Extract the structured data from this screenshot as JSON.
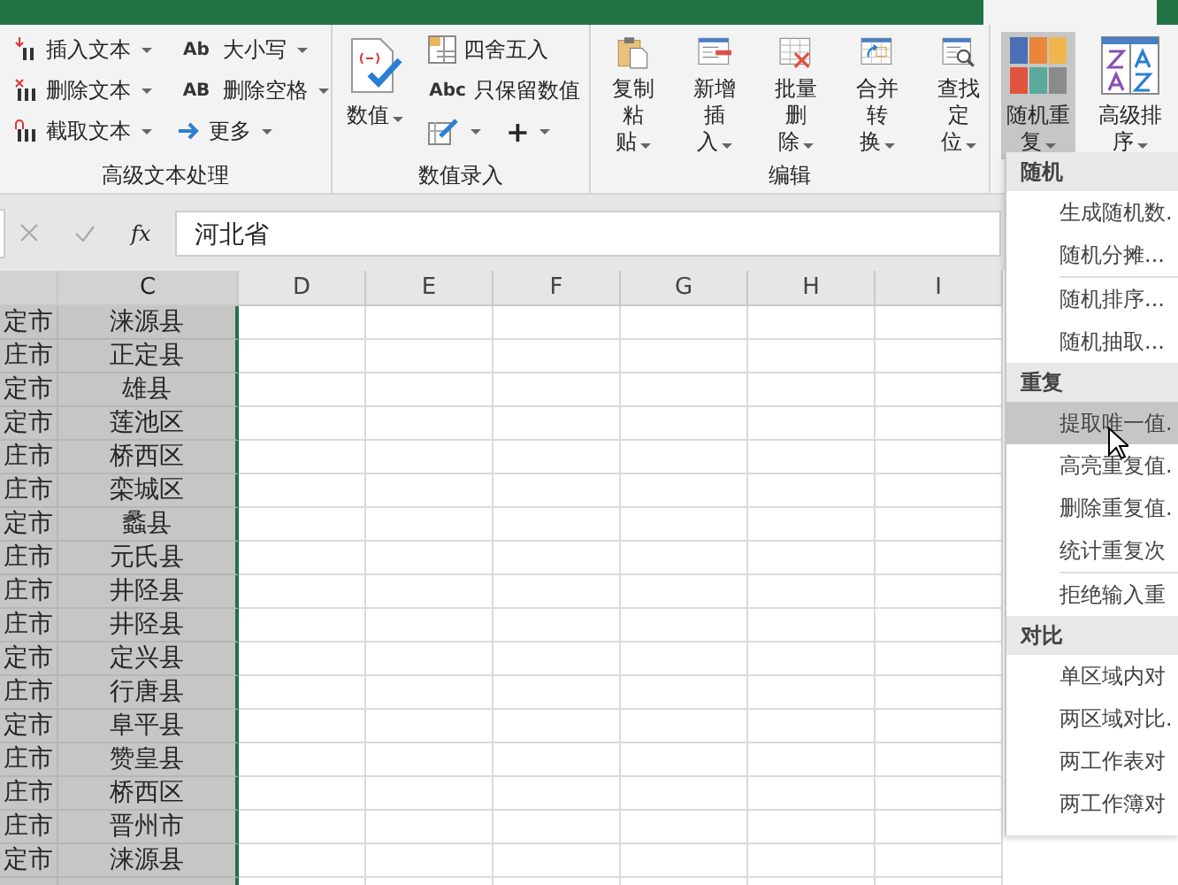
{
  "ribbon": {
    "groups": [
      {
        "label": "高级文本处理",
        "columns": [
          [
            {
              "label": "插入文本",
              "dropdown": true
            },
            {
              "label": "删除文本",
              "dropdown": true
            },
            {
              "label": "截取文本",
              "dropdown": true
            }
          ],
          [
            {
              "label": "大小写",
              "glyph": "Ab",
              "dropdown": true
            },
            {
              "label": "删除空格",
              "glyph": "AB",
              "dropdown": true
            },
            {
              "label": "更多",
              "dropdown": true
            }
          ]
        ]
      },
      {
        "label": "数值录入",
        "big": [
          {
            "label": [
              "数值"
            ],
            "dropdown": true,
            "pressed": false
          }
        ],
        "columns": [
          [
            {
              "label": "四舍五入",
              "dropdown": false
            },
            {
              "label": "只保留数值",
              "glyph": "Abc",
              "dropdown": false
            }
          ]
        ],
        "icon_row": [
          {
            "dropdown": true
          },
          {
            "glyph": "+",
            "dropdown": true
          }
        ]
      },
      {
        "label": "编辑",
        "big": [
          {
            "label": [
              "复制粘",
              "贴"
            ],
            "dropdown": true,
            "pressed": false
          },
          {
            "label": [
              "新增插",
              "入"
            ],
            "dropdown": true,
            "pressed": false
          },
          {
            "label": [
              "批量删",
              "除"
            ],
            "dropdown": true,
            "pressed": false
          },
          {
            "label": [
              "合并转",
              "换"
            ],
            "dropdown": true,
            "pressed": false
          },
          {
            "label": [
              "查找定",
              "位"
            ],
            "dropdown": true,
            "pressed": false
          }
        ]
      },
      {
        "big": [
          {
            "label": [
              "随机重",
              "复"
            ],
            "dropdown": true,
            "pressed": true
          },
          {
            "label": [
              "高级排",
              "序"
            ],
            "dropdown": true,
            "pressed": false
          }
        ]
      }
    ]
  },
  "formula_bar": {
    "fx": "fx",
    "value": "河北省"
  },
  "sheet": {
    "columns": [
      {
        "selected": true
      },
      {
        "header": "C",
        "selected": true
      },
      {
        "header": "D",
        "selected": false
      },
      {
        "header": "E",
        "selected": false
      },
      {
        "header": "F",
        "selected": false
      },
      {
        "header": "G",
        "selected": false
      },
      {
        "header": "H",
        "selected": false
      },
      {
        "header": "I",
        "selected": false
      }
    ],
    "rows": [
      [
        "定市",
        "涞源县"
      ],
      [
        "庄市",
        "正定县"
      ],
      [
        "定市",
        "雄县"
      ],
      [
        "定市",
        "莲池区"
      ],
      [
        "庄市",
        "桥西区"
      ],
      [
        "庄市",
        "栾城区"
      ],
      [
        "定市",
        "蠡县"
      ],
      [
        "庄市",
        "元氏县"
      ],
      [
        "庄市",
        "井陉县"
      ],
      [
        "庄市",
        "井陉县"
      ],
      [
        "定市",
        "定兴县"
      ],
      [
        "庄市",
        "行唐县"
      ],
      [
        "定市",
        "阜平县"
      ],
      [
        "庄市",
        "赞皇县"
      ],
      [
        "庄市",
        "桥西区"
      ],
      [
        "庄市",
        "晋州市"
      ],
      [
        "定市",
        "涞源县"
      ]
    ]
  },
  "menu": {
    "sections": [
      {
        "header": "随机",
        "items": [
          {
            "label": "生成随机数.",
            "selected": false,
            "divider_after": false
          },
          {
            "label": "随机分摊...",
            "selected": false,
            "divider_after": true
          },
          {
            "label": "随机排序...",
            "selected": false,
            "divider_after": false
          },
          {
            "label": "随机抽取...",
            "selected": false,
            "divider_after": false
          }
        ]
      },
      {
        "header": "重复",
        "items": [
          {
            "label": "提取唯一值.",
            "selected": true,
            "divider_after": false
          },
          {
            "label": "高亮重复值.",
            "selected": false,
            "divider_after": false
          },
          {
            "label": "删除重复值.",
            "selected": false,
            "divider_after": false
          },
          {
            "label": "统计重复次",
            "selected": false,
            "divider_after": true
          },
          {
            "label": "拒绝输入重",
            "selected": false,
            "divider_after": false
          }
        ]
      },
      {
        "header": "对比",
        "items": [
          {
            "label": "单区域内对",
            "selected": false,
            "divider_after": false
          },
          {
            "label": "两区域对比.",
            "selected": false,
            "divider_after": false
          },
          {
            "label": "两工作表对",
            "selected": false,
            "divider_after": false
          },
          {
            "label": "两工作簿对",
            "selected": false,
            "divider_after": false
          }
        ]
      }
    ]
  }
}
